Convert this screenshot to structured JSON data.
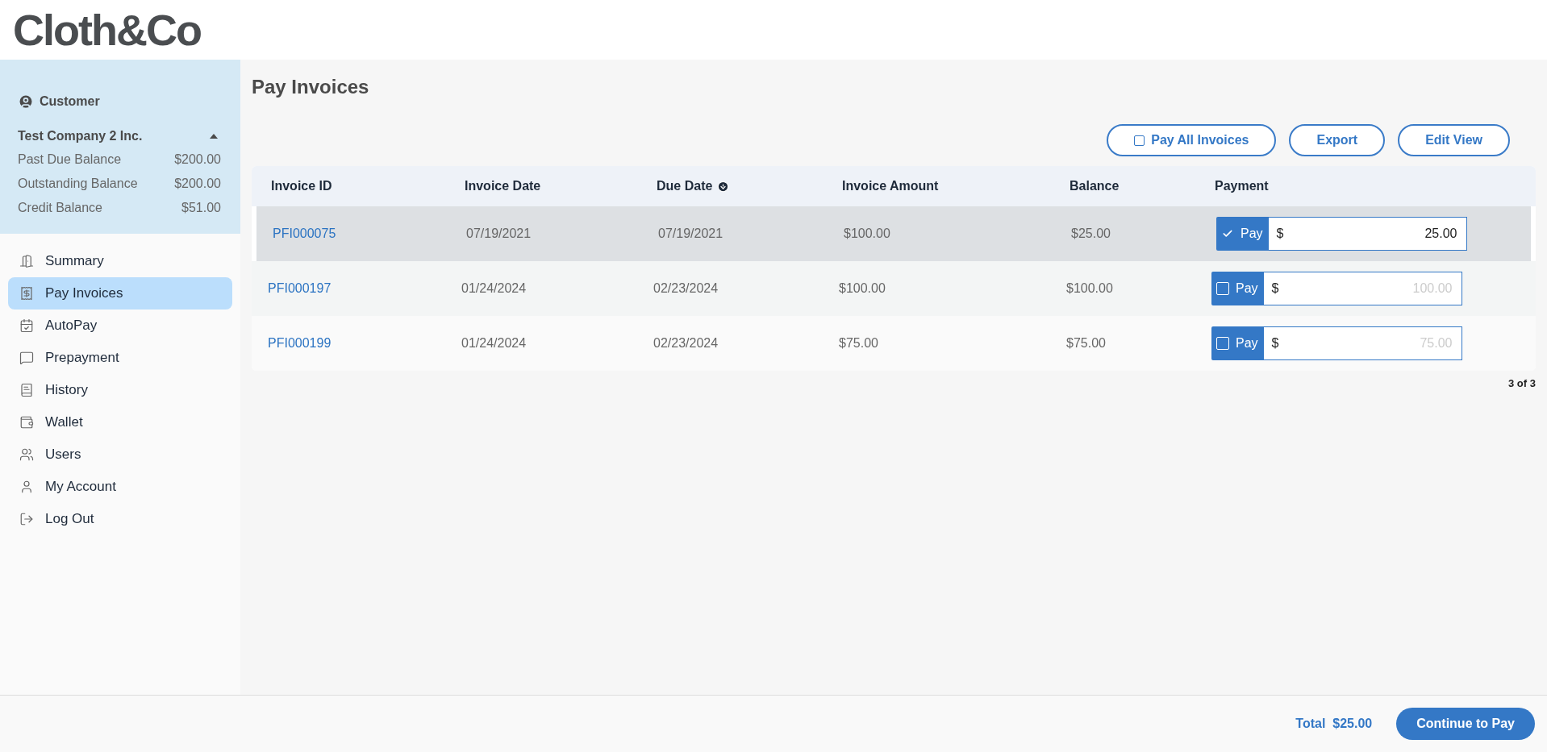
{
  "logo": "Cloth&Co",
  "customer": {
    "label": "Customer",
    "company": "Test Company 2 Inc.",
    "expanded": true,
    "balances": [
      {
        "label": "Past Due Balance",
        "value": "$200.00"
      },
      {
        "label": "Outstanding Balance",
        "value": "$200.00"
      },
      {
        "label": "Credit Balance",
        "value": "$51.00"
      }
    ]
  },
  "nav": [
    {
      "kind": "summary",
      "label": "Summary",
      "selected": false
    },
    {
      "kind": "invoices",
      "label": "Pay Invoices",
      "selected": true
    },
    {
      "kind": "autopay",
      "label": "AutoPay",
      "selected": false
    },
    {
      "kind": "prepayment",
      "label": "Prepayment",
      "selected": false
    },
    {
      "kind": "history",
      "label": "History",
      "selected": false
    },
    {
      "kind": "wallet",
      "label": "Wallet",
      "selected": false
    },
    {
      "kind": "users",
      "label": "Users",
      "selected": false
    },
    {
      "kind": "account",
      "label": "My Account",
      "selected": false
    },
    {
      "kind": "logout",
      "label": "Log Out",
      "selected": false
    }
  ],
  "page_title": "Pay Invoices",
  "actions": {
    "pay_all": {
      "label": "Pay All Invoices",
      "checked": false
    },
    "buttons": [
      "Export",
      "Edit View"
    ]
  },
  "table": {
    "columns": [
      {
        "label": "Invoice ID",
        "sorted": false
      },
      {
        "label": "Invoice Date",
        "sorted": false
      },
      {
        "label": "Due Date",
        "sorted": true
      },
      {
        "label": "Invoice Amount",
        "sorted": false
      },
      {
        "label": "Balance",
        "sorted": false
      },
      {
        "label": "Payment",
        "sorted": false
      }
    ],
    "rows": [
      {
        "id": "PFI000075",
        "invoice_date": "07/19/2021",
        "due_date": "07/19/2021",
        "amount": "$100.00",
        "balance": "$25.00",
        "pay_label": "Pay",
        "checked": true,
        "currency": "$",
        "value": "25.00"
      },
      {
        "id": "PFI000197",
        "invoice_date": "01/24/2024",
        "due_date": "02/23/2024",
        "amount": "$100.00",
        "balance": "$100.00",
        "pay_label": "Pay",
        "checked": false,
        "currency": "$",
        "placeholder": "100.00"
      },
      {
        "id": "PFI000199",
        "invoice_date": "01/24/2024",
        "due_date": "02/23/2024",
        "amount": "$75.00",
        "balance": "$75.00",
        "pay_label": "Pay",
        "checked": false,
        "currency": "$",
        "placeholder": "75.00"
      }
    ],
    "count": "3 of 3"
  },
  "footer": {
    "total_label": "Total",
    "total": "$25.00",
    "button": "Continue to Pay"
  }
}
